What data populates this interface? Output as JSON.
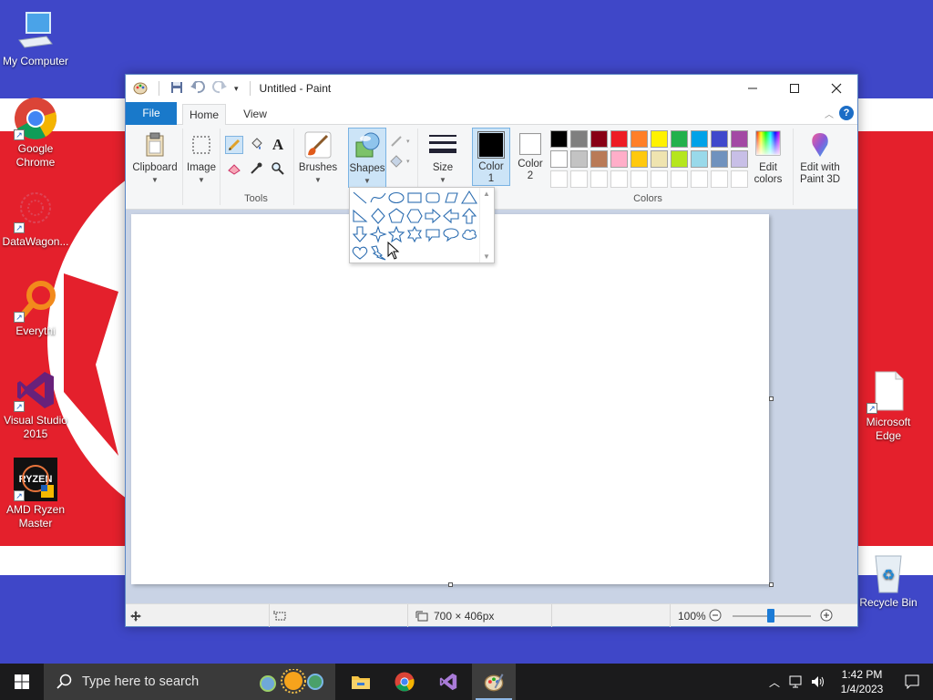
{
  "desktop": {
    "icons": [
      {
        "label": "My Computer"
      },
      {
        "label": "Google Chrome"
      },
      {
        "label": "DataWagon..."
      },
      {
        "label": "Everythi"
      },
      {
        "label": "Visual Studio 2015"
      },
      {
        "label": "AMD Ryzen Master"
      },
      {
        "label": "Microsoft Edge"
      },
      {
        "label": "Recycle Bin"
      }
    ]
  },
  "window": {
    "title": "Untitled - Paint",
    "tabs": {
      "file": "File",
      "home": "Home",
      "view": "View"
    },
    "help": "?"
  },
  "ribbon": {
    "clipboard": "Clipboard",
    "image": "Image",
    "tools_group": "Tools",
    "brushes": "Brushes",
    "shapes": "Shapes",
    "size": "Size",
    "color1": "Color\n1",
    "color1_a": "Color",
    "color1_b": "1",
    "color2_a": "Color",
    "color2_b": "2",
    "colors_group": "Colors",
    "edit_colors_a": "Edit",
    "edit_colors_b": "colors",
    "paint3d_a": "Edit with",
    "paint3d_b": "Paint 3D",
    "color1_value": "#000000",
    "color2_value": "#ffffff",
    "palette_row1": [
      "#000000",
      "#7f7f7f",
      "#880015",
      "#ed1c24",
      "#ff7f27",
      "#fff200",
      "#22b14c",
      "#00a2e8",
      "#3f48cc",
      "#a349a4"
    ],
    "palette_row2": [
      "#ffffff",
      "#c3c3c3",
      "#b97a57",
      "#ffaec9",
      "#ffc90e",
      "#efe4b0",
      "#b5e61d",
      "#99d9ea",
      "#7092be",
      "#c8bfe7"
    ]
  },
  "status": {
    "dimensions": "700 × 406px",
    "zoom": "100%"
  },
  "taskbar": {
    "search_placeholder": "Type here to search",
    "time": "1:42 PM",
    "date": "1/4/2023"
  }
}
